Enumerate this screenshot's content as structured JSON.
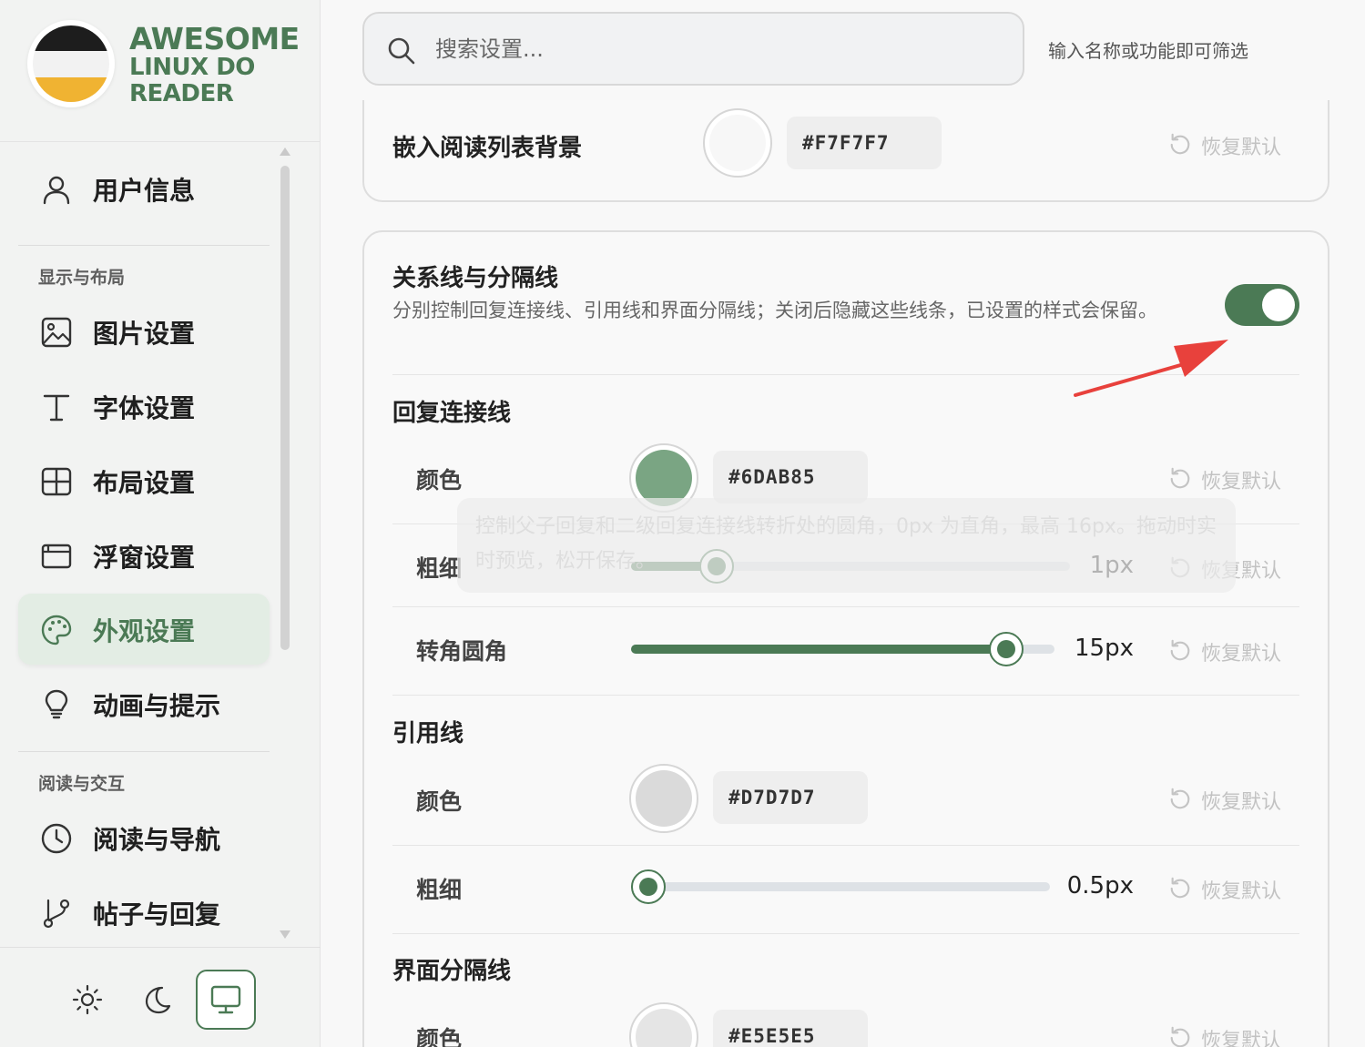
{
  "brand": {
    "line1": "AWESOME",
    "line2": "LINUX DO",
    "line3": "READER"
  },
  "sidebar": {
    "user_info": "用户信息",
    "group_display": "显示与布局",
    "items_display": [
      "图片设置",
      "字体设置",
      "布局设置",
      "浮窗设置",
      "外观设置",
      "动画与提示"
    ],
    "group_reading": "阅读与交互",
    "items_reading": [
      "阅读与导航",
      "帖子与回复"
    ],
    "active_item": "外观设置"
  },
  "theme": {
    "options": [
      "light",
      "dark",
      "system"
    ],
    "selected": "system"
  },
  "search": {
    "placeholder": "搜索设置...",
    "hint": "输入名称或功能即可筛选"
  },
  "reset_label": "恢复默认",
  "embed_bg": {
    "label": "嵌入阅读列表背景",
    "color": "#F7F7F7"
  },
  "lines_section": {
    "title": "关系线与分隔线",
    "description": "分别控制回复连接线、引用线和界面分隔线；关闭后隐藏这些线条，已设置的样式会保留。",
    "enabled": true
  },
  "reply_line": {
    "title": "回复连接线",
    "color_label": "颜色",
    "color": "#6DAB85",
    "width_label": "粗细",
    "width_value": "1px",
    "width_fraction": 0.17,
    "radius_label": "转角圆角",
    "radius_value": "15px",
    "radius_fraction": 0.92,
    "tooltip": "控制父子回复和二级回复连接线转折处的圆角，0px 为直角，最高 16px。拖动时实时预览，松开保存。"
  },
  "quote_line": {
    "title": "引用线",
    "color_label": "颜色",
    "color": "#D7D7D7",
    "width_label": "粗细",
    "width_value": "0.5px",
    "width_fraction": 0.0
  },
  "ui_divider": {
    "title": "界面分隔线",
    "color_label": "颜色",
    "color": "#E5E5E5"
  },
  "colors": {
    "accent": "#4b7a55",
    "reply_swatch": "#7aa583",
    "quote_swatch": "#dadada",
    "divider_swatch": "#e5e5e5",
    "embed_swatch": "#f7f7f7",
    "annotation_arrow": "#e8413c"
  }
}
